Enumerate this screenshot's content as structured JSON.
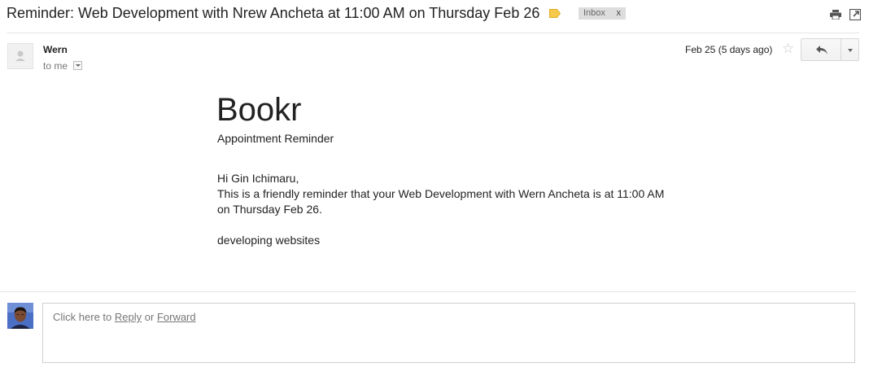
{
  "message": {
    "subject": "Reminder: Web Development with Nrew Ancheta at 11:00 AM on Thursday Feb 26",
    "label_color": "#f6c94a",
    "inbox_label": "Inbox",
    "inbox_remove": "x",
    "sender": "Wern",
    "recipient": "to me",
    "date": "Feb 25 (5 days ago)",
    "star": "☆"
  },
  "body": {
    "brand": "Bookr",
    "subtitle": "Appointment Reminder",
    "greeting": "Hi Gin Ichimaru,",
    "line1": "This is a friendly reminder that your Web Development with Wern Ancheta is at 11:00 AM",
    "line2": "on Thursday Feb 26.",
    "note": "developing websites"
  },
  "reply": {
    "prefix": "Click here to",
    "reply_link": "Reply",
    "or": "or",
    "forward_link": "Forward"
  },
  "icons": {
    "label": "label-tag-icon",
    "print": "print-icon",
    "new_window": "new-window-icon",
    "reply": "reply-arrow-icon",
    "more": "chevron-down-icon",
    "star": "star-icon"
  }
}
